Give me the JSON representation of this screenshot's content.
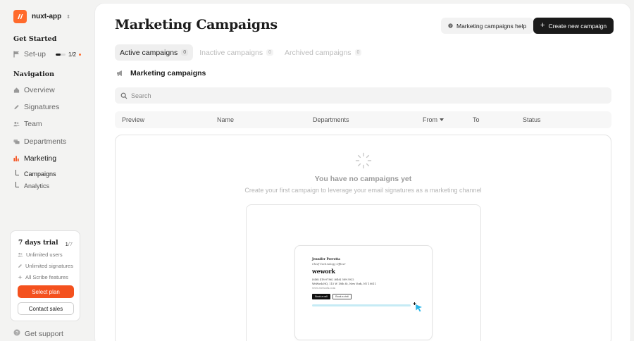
{
  "app": {
    "name": "nuxt-app"
  },
  "sidebar": {
    "get_started_title": "Get Started",
    "setup": {
      "label": "Set-up",
      "progress_text": "1/2",
      "progress_fraction": 0.5
    },
    "navigation_title": "Navigation",
    "nav_items": [
      {
        "label": "Overview",
        "icon": "home-icon"
      },
      {
        "label": "Signatures",
        "icon": "pencil-icon"
      },
      {
        "label": "Team",
        "icon": "users-icon"
      },
      {
        "label": "Departments",
        "icon": "departments-icon"
      },
      {
        "label": "Marketing",
        "icon": "chart-bars-icon",
        "active": true
      }
    ],
    "sub_items": [
      {
        "label": "Campaigns",
        "active": true
      },
      {
        "label": "Analytics",
        "active": false
      }
    ],
    "trial": {
      "title": "7 days trial",
      "current": "1",
      "total": "/7",
      "features": [
        "Unlimited users",
        "Unlimited signatures",
        "All Scribe features"
      ],
      "select_plan": "Select plan",
      "contact_sales": "Contact sales"
    },
    "support": "Get support"
  },
  "main": {
    "title": "Marketing Campaigns",
    "help_button": "Marketing campaigns help",
    "create_button": "Create new campaign",
    "tabs": [
      {
        "label": "Active campaigns",
        "count": "0",
        "active": true
      },
      {
        "label": "Inactive campaigns",
        "count": "0",
        "active": false
      },
      {
        "label": "Archived campaigns",
        "count": "0",
        "active": false
      }
    ],
    "section_title": "Marketing campaigns",
    "search_placeholder": "Search",
    "columns": [
      "Preview",
      "Name",
      "Departments",
      "From",
      "To",
      "Status"
    ],
    "empty": {
      "title": "You have no campaigns yet",
      "subtitle": "Create your first campaign to leverage your email signatures as a marketing channel"
    },
    "signature_preview": {
      "name": "Jennifer Perrotta",
      "role": "Chief Technology Officer",
      "company": "wework",
      "phone": "(646) 418-0786 | (646) 389-3922",
      "address": "WeWork HQ, 115 W 18th St, New York, NY 10011",
      "website": "www.wework.com",
      "button_call": "Book a call",
      "button_visit": "Book a visit"
    }
  },
  "colors": {
    "accent": "#f4511e",
    "brand": "#ff6a2c",
    "dark": "#1a1a1a"
  }
}
